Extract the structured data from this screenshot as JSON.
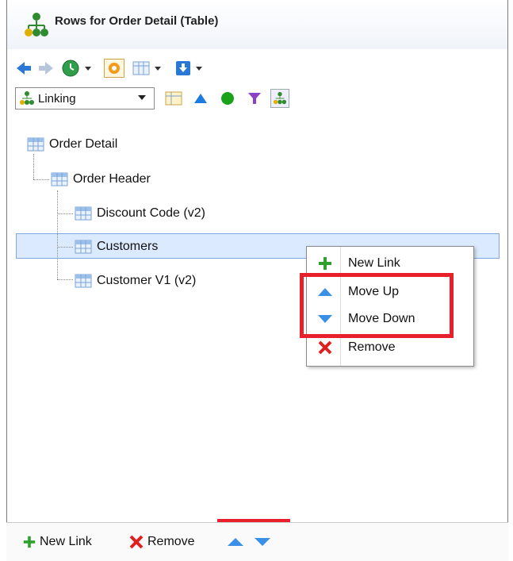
{
  "window": {
    "title": "Rows for Order Detail (Table)"
  },
  "toolbar": {
    "combo_value": "Linking"
  },
  "tree": {
    "root": "Order Detail",
    "child": "Order Header",
    "grandchildren": [
      "Discount Code (v2)",
      "Customers",
      "Customer V1 (v2)"
    ]
  },
  "context_menu": {
    "items": [
      "New Link",
      "Move Up",
      "Move Down",
      "Remove"
    ]
  },
  "bottom_bar": {
    "new_link": "New Link",
    "remove": "Remove"
  },
  "colors": {
    "highlight": "#e8202a",
    "selection": "#dceaff",
    "accent_blue": "#1e7be0",
    "green": "#1aa31a"
  }
}
